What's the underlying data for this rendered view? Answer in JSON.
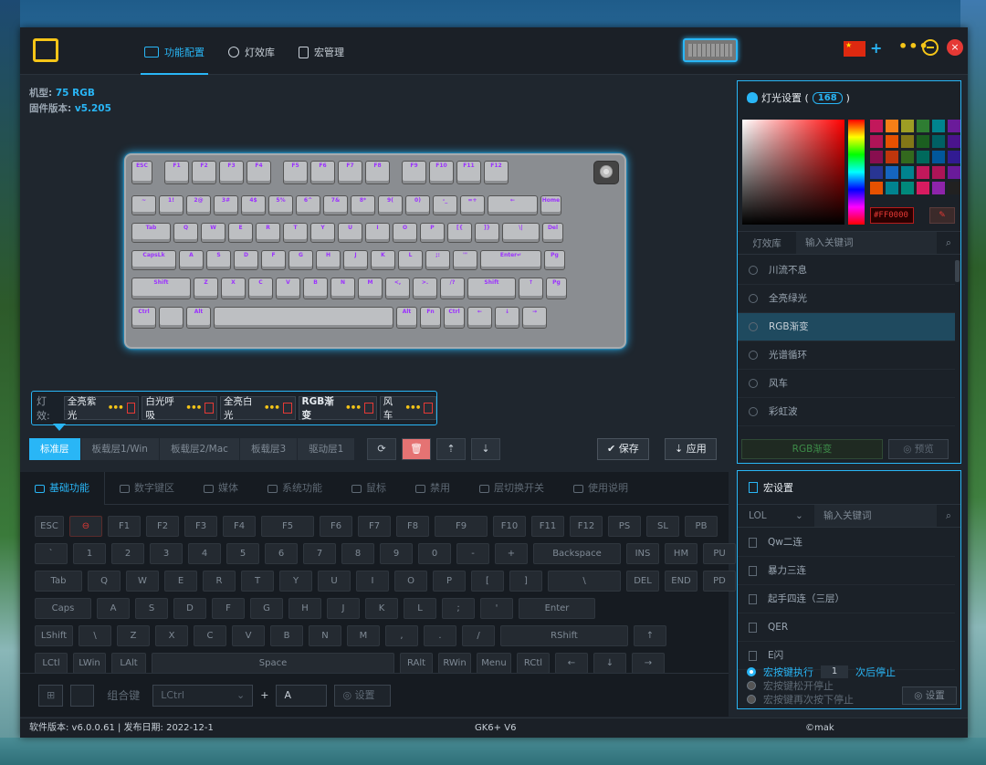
{
  "header": {
    "nav": [
      {
        "label": "功能配置",
        "icon": "keyboard-icon"
      },
      {
        "label": "灯效库",
        "icon": "sun-icon"
      },
      {
        "label": "宏管理",
        "icon": "document-icon"
      }
    ],
    "plus": "+",
    "dots": "•••",
    "close": "×"
  },
  "device": {
    "model_label": "机型:",
    "model_value": "75 RGB",
    "firmware_label": "固件版本:",
    "firmware_value": "v5.205"
  },
  "keyboard_rows": [
    [
      "ESC",
      "F1",
      "F2",
      "F3",
      "F4",
      "F5",
      "F6",
      "F7",
      "F8",
      "F9",
      "F10",
      "F11",
      "F12"
    ],
    [
      "~",
      "1!",
      "2@",
      "3#",
      "4$",
      "5%",
      "6^",
      "7&",
      "8*",
      "9(",
      "0)",
      "-_",
      "=+",
      "←",
      "Home"
    ],
    [
      "Tab",
      "Q",
      "W",
      "E",
      "R",
      "T",
      "Y",
      "U",
      "I",
      "O",
      "P",
      "[{",
      "]}",
      "\\|",
      "Del"
    ],
    [
      "CapsLk",
      "A",
      "S",
      "D",
      "F",
      "G",
      "H",
      "J",
      "K",
      "L",
      ";:",
      "'\"",
      "Enter↵",
      "Pg"
    ],
    [
      "Shift",
      "Z",
      "X",
      "C",
      "V",
      "B",
      "N",
      "M",
      "<,",
      ">.",
      "/?",
      "Shift",
      "↑",
      "Pg"
    ],
    [
      "Ctrl",
      "",
      "Alt",
      "",
      "Alt",
      "Fn",
      "Ctrl",
      "←",
      "↓",
      "→"
    ]
  ],
  "effects": {
    "label": "灯效:",
    "items": [
      "全亮紫光",
      "白光呼吸",
      "全亮白光",
      "RGB渐变",
      "风车"
    ],
    "edit_glyph": "•••"
  },
  "layers": [
    "标准层",
    "板载层1/Win",
    "板载层2/Mac",
    "板载层3",
    "驱动层1"
  ],
  "tools": [
    "⟳",
    "🗑",
    "⇡",
    "⇣"
  ],
  "actions": {
    "save": "✔ 保存",
    "apply": "⇣ 应用"
  },
  "tabs": [
    {
      "label": "基础功能"
    },
    {
      "label": "数字键区"
    },
    {
      "label": "媒体"
    },
    {
      "label": "系统功能"
    },
    {
      "label": "鼠标"
    },
    {
      "label": "禁用"
    },
    {
      "label": "层切换开关"
    },
    {
      "label": "使用说明"
    }
  ],
  "vkeys": {
    "r1": [
      "ESC",
      "⊖",
      "F1",
      "F2",
      "F3",
      "F4",
      "F5",
      "F6",
      "F7",
      "F8",
      "F9",
      "F10",
      "F11",
      "F12",
      "PS",
      "SL",
      "PB"
    ],
    "r2": [
      "`",
      "1",
      "2",
      "3",
      "4",
      "5",
      "6",
      "7",
      "8",
      "9",
      "0",
      "-",
      "+",
      "Backspace",
      "INS",
      "HM",
      "PU"
    ],
    "r3": [
      "Tab",
      "Q",
      "W",
      "E",
      "R",
      "T",
      "Y",
      "U",
      "I",
      "O",
      "P",
      "[",
      "]",
      "\\",
      "DEL",
      "END",
      "PD"
    ],
    "r4": [
      "Caps",
      "A",
      "S",
      "D",
      "F",
      "G",
      "H",
      "J",
      "K",
      "L",
      ";",
      "'",
      "Enter"
    ],
    "r5": [
      "LShift",
      "\\",
      "Z",
      "X",
      "C",
      "V",
      "B",
      "N",
      "M",
      ",",
      ".",
      "/",
      "RShift",
      "↑"
    ],
    "r6": [
      "LCtl",
      "LWin",
      "LAlt",
      "Space",
      "RAlt",
      "RWin",
      "Menu",
      "RCtl",
      "←",
      "↓",
      "→"
    ]
  },
  "combo": {
    "label": "组合键",
    "modifier": "LCtrl",
    "plus": "+",
    "key": "A",
    "set": "设置",
    "win": "⊞",
    "apple": ""
  },
  "status": {
    "version": "软件版本: v6.0.0.61 | 发布日期: 2022-12-1",
    "model": "GK6+ V6",
    "copyright": "©mak"
  },
  "light": {
    "title": "灯光设置 (",
    "count": "168",
    "title_close": ")",
    "hex": "#FF0000",
    "library_label": "灯效库",
    "search_placeholder": "输入关键词",
    "list": [
      "川流不息",
      "全亮绿光",
      "RGB渐变",
      "光谱循环",
      "风车",
      "彩虹波"
    ],
    "current": "RGB渐变",
    "preview": "◎ 预览",
    "swatches": [
      "#c2185b",
      "#f57f17",
      "#9e9d24",
      "#2e7d32",
      "#00838f",
      "#6a1b9a",
      "#ad1457",
      "#e65100",
      "#827717",
      "#1b5e20",
      "#006064",
      "#4a148c",
      "#880e4f",
      "#bf360c",
      "#33691e",
      "#00695c",
      "#01579b",
      "#311b92",
      "#283593",
      "#1565c0",
      "#00838f",
      "#c2185b",
      "#ad1457",
      "#6a1b9a",
      "#e65100",
      "#00838f",
      "#00897b",
      "#d81b60",
      "#8e24aa",
      "#212121"
    ]
  },
  "macro": {
    "title": "宏设置",
    "select": "LOL",
    "search_placeholder": "输入关键词",
    "list": [
      "Qw二连",
      "暴力三连",
      "起手四连（三层）",
      "QER",
      "E闪"
    ],
    "opt1_a": "宏按键执行",
    "opt1_num": "1",
    "opt1_b": "次后停止",
    "opt2": "宏按键松开停止",
    "opt3": "宏按键再次按下停止",
    "set": "◎ 设置"
  }
}
